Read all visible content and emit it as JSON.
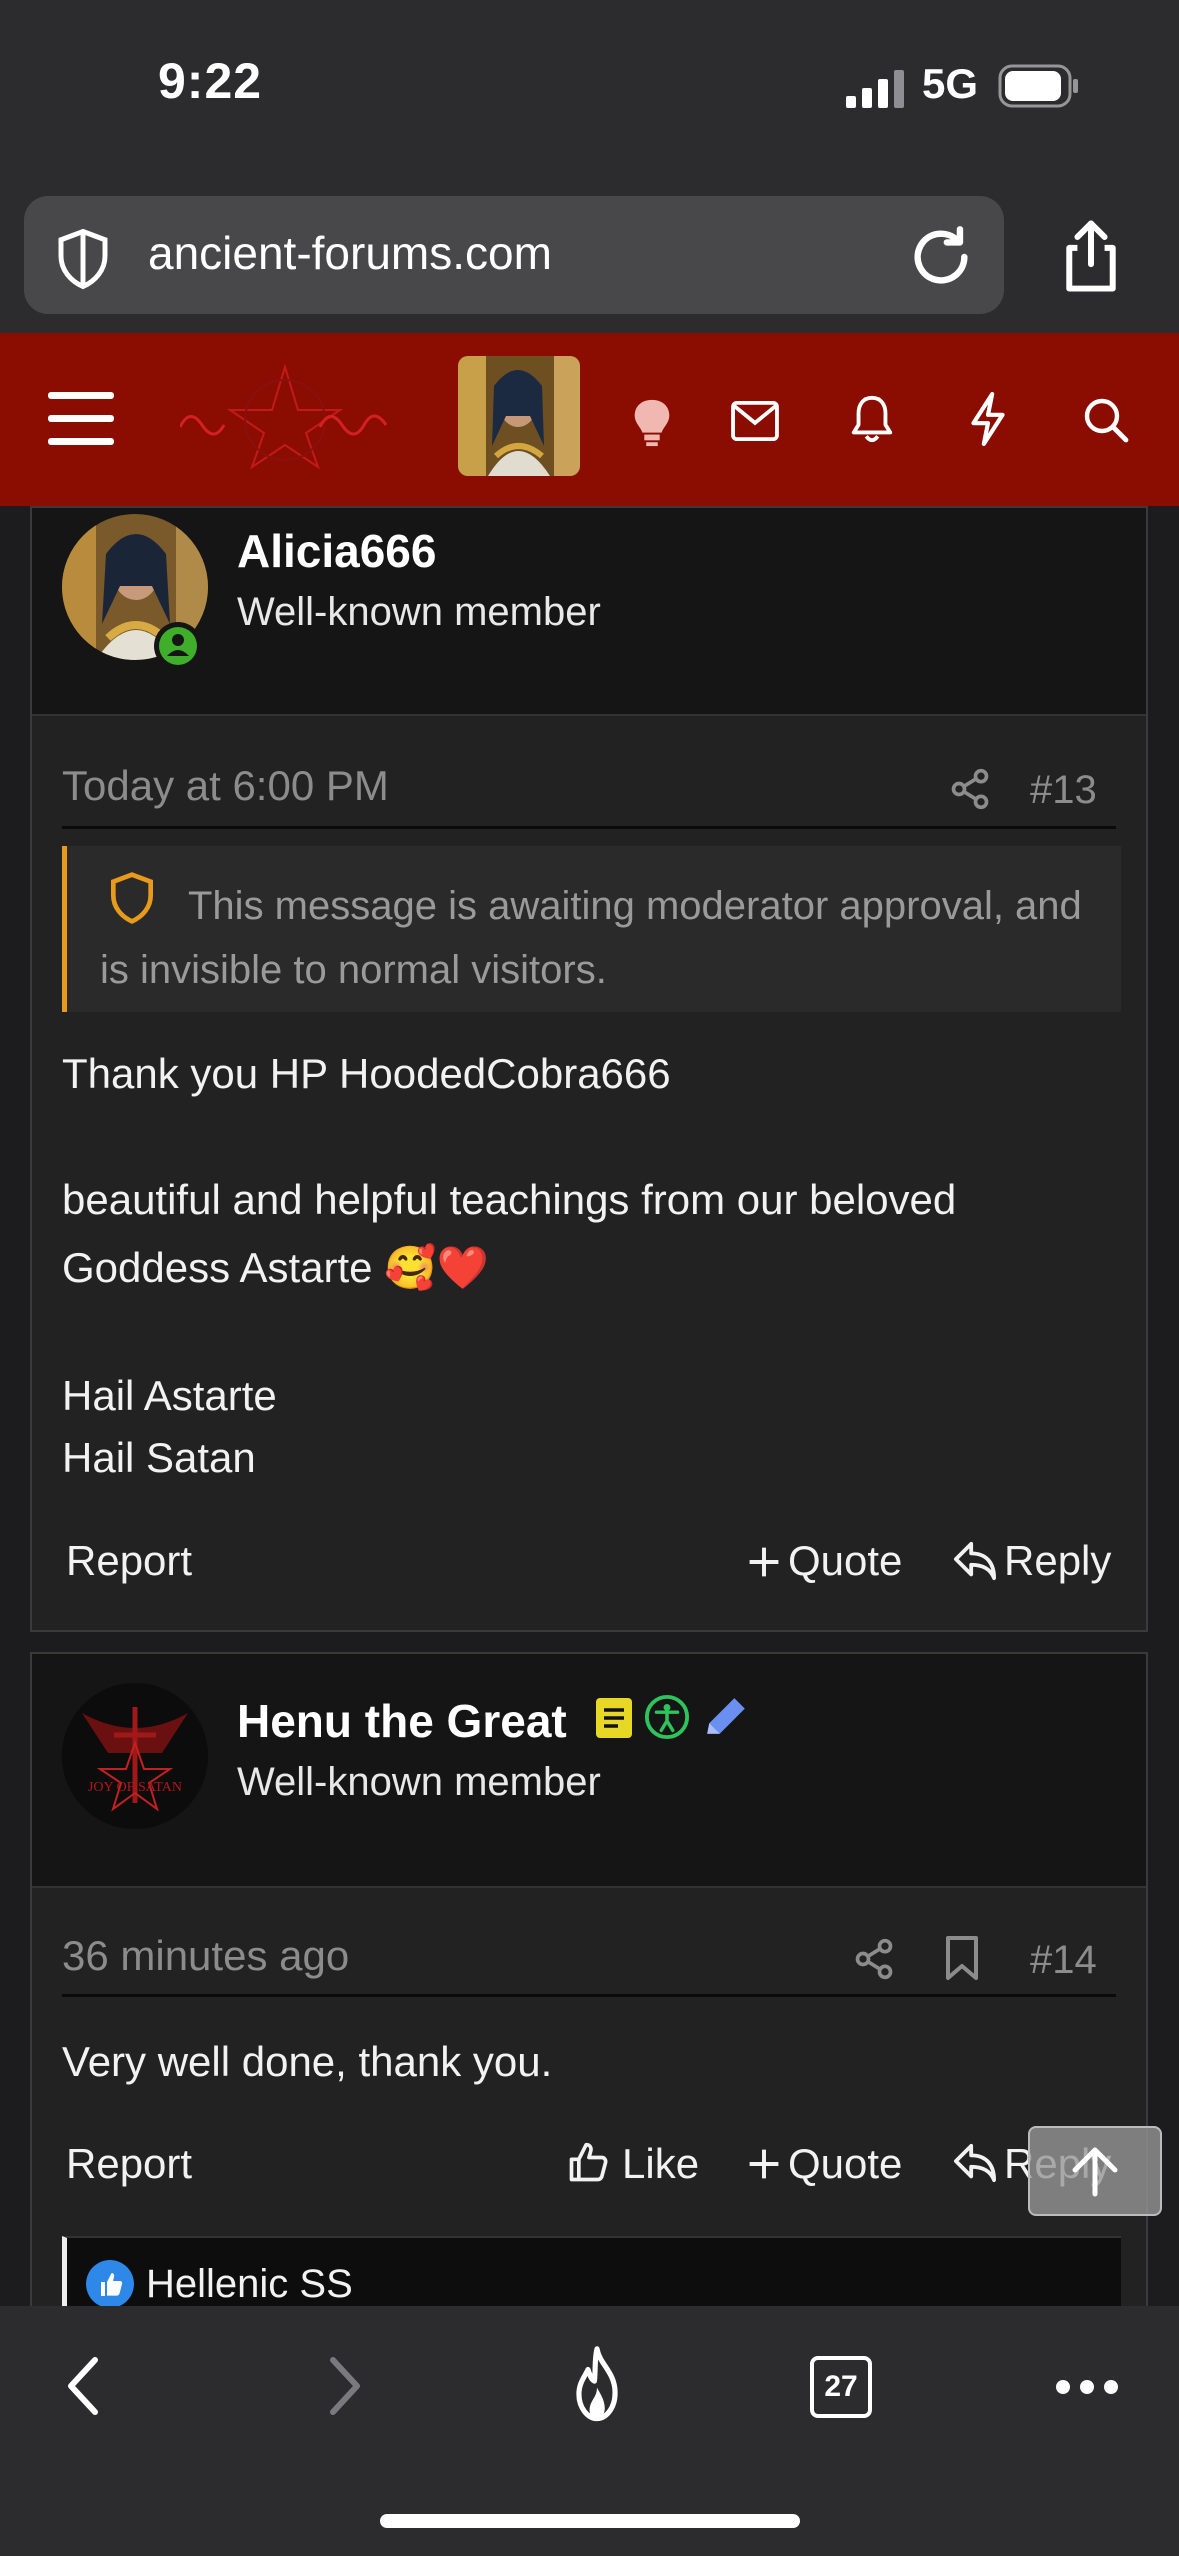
{
  "status_bar": {
    "time": "9:22",
    "network": "5G"
  },
  "browser": {
    "url": "ancient-forums.com",
    "tab_count": "27"
  },
  "forum_header": {
    "menu_icon": "hamburger-icon",
    "logo_alt": "Joy of Satan logo",
    "accent": "#8b0d02"
  },
  "posts": [
    {
      "author": "Alicia666",
      "role": "Well-known member",
      "time": "Today at 6:00 PM",
      "number": "#13",
      "notice": "This message is awaiting moderator approval, and is invisible to normal visitors.",
      "body": {
        "line1": "Thank you HP HoodedCobra666",
        "line2": "beautiful and helpful teachings from our beloved",
        "line3": "Goddess Astarte 🥰❤️",
        "line4": "Hail Astarte",
        "line5": "Hail Satan"
      },
      "actions": {
        "report": "Report",
        "quote": "Quote",
        "reply": "Reply"
      }
    },
    {
      "author": "Henu the Great",
      "role": "Well-known member",
      "time": "36 minutes ago",
      "number": "#14",
      "body": {
        "line1": "Very well done, thank you."
      },
      "actions": {
        "report": "Report",
        "like": "Like",
        "quote": "Quote",
        "reply": "Reply"
      },
      "reactions": {
        "user": "Hellenic SS"
      }
    }
  ]
}
